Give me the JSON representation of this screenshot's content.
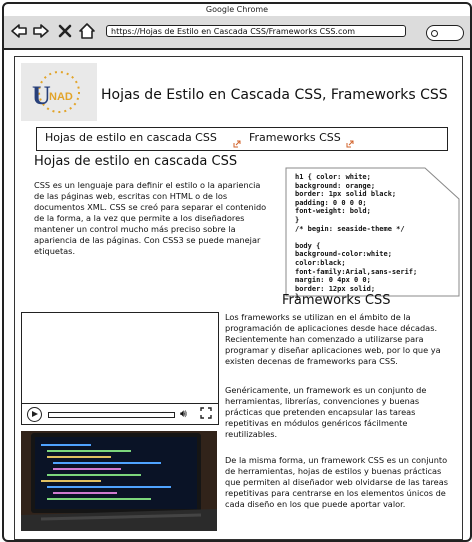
{
  "browser": {
    "title": "Google Chrome",
    "url": "https://Hojas de Estilo en Cascada CSS/Frameworks CSS.com"
  },
  "header": {
    "logo_text": "UNAD",
    "title": "Hojas de Estilo en Cascada CSS, Frameworks CSS"
  },
  "nav": {
    "links": [
      "Hojas de estilo en cascada CSS",
      "Frameworks CSS"
    ]
  },
  "css_section": {
    "heading": "Hojas de estilo en cascada CSS",
    "paragraph": "CSS es un lenguaje para definir el estilo o la apariencia de las páginas web, escritas con HTML o de los documentos XML. CSS se creó para separar el contenido de la forma, a la vez que permite a los diseñadores mantener un control mucho más preciso sobre la apariencia de las páginas. Con CSS3 se puede manejar etiquetas.",
    "code": "h1 { color: white;\nbackground: orange;\nborder: 1px solid black;\npadding: 0 0 0 0;\nfont-weight: bold;\n}\n/* begin: seaside-theme */\n\nbody {\nbackground-color:white;\ncolor:black;\nfont-family:Arial,sans-serif;\nmargin: 0 4px 0 0;\nborder: 12px solid;\n}"
  },
  "frameworks_section": {
    "heading": "Frameworks CSS",
    "paragraphs": [
      "Los frameworks se utilizan en el ámbito de la programación de aplicaciones desde hace décadas. Recientemente han comenzado a utilizarse para programar y diseñar aplicaciones web, por lo que ya existen decenas de frameworks para CSS.",
      "Genéricamente, un framework es un conjunto de herramientas, librerías, convenciones y buenas prácticas que pretenden encapsular las tareas repetitivas en módulos genéricos fácilmente reutilizables.",
      "De la misma forma, un framework CSS es un conjunto de herramientas, hojas de estilos y buenas prácticas que permiten al diseñador web olvidarse de las tareas repetitivas para centrarse en los elementos únicos de cada diseño en los que puede aportar valor."
    ]
  },
  "icons": {
    "back": "arrow-left-icon",
    "forward": "arrow-right-icon",
    "close": "close-icon",
    "home": "home-icon",
    "external": "external-link-icon",
    "play": "play-icon",
    "volume": "volume-icon",
    "fullscreen": "fullscreen-icon"
  },
  "colors": {
    "toolbar": "#dcdcdc",
    "accent": "#d2622a"
  }
}
